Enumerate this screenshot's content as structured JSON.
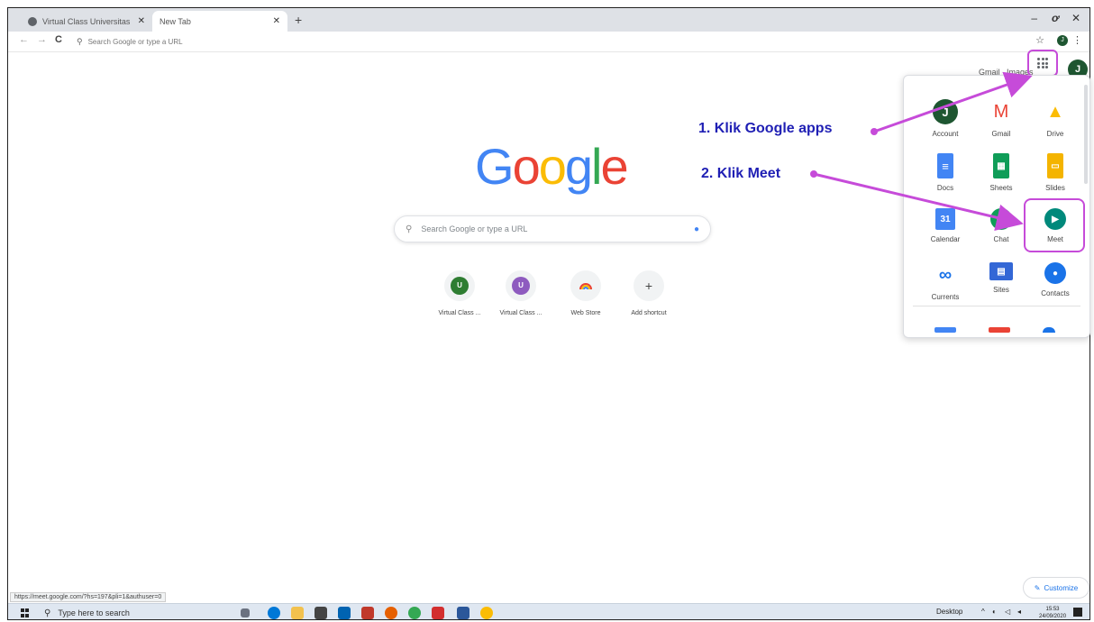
{
  "browser": {
    "tabs": [
      {
        "title": "Virtual Class Universitas Klabat",
        "active": false
      },
      {
        "title": "New Tab",
        "active": true
      }
    ],
    "omnibox_placeholder": "Search Google or type a URL",
    "avatar_letter": "J",
    "status_url": "https://meet.google.com/?hs=197&pli=1&authuser=0"
  },
  "page": {
    "links": {
      "gmail": "Gmail",
      "images": "Images"
    },
    "avatar_letter": "J",
    "logo_letters": [
      "G",
      "o",
      "o",
      "g",
      "l",
      "e"
    ],
    "logo_colors": [
      "#4285F4",
      "#EA4335",
      "#FBBC05",
      "#4285F4",
      "#34A853",
      "#EA4335"
    ],
    "search_placeholder": "Search Google or type a URL",
    "shortcuts": [
      {
        "label": "Virtual Class ...",
        "letter": "U",
        "color": "#2e7d32"
      },
      {
        "label": "Virtual Class ...",
        "letter": "U",
        "color": "#8e5bbf"
      },
      {
        "label": "Web Store",
        "letter": "",
        "color": "#f1f3f4"
      },
      {
        "label": "Add shortcut",
        "letter": "+",
        "color": "#f1f3f4"
      }
    ],
    "customize_label": "Customize"
  },
  "apps_panel": {
    "apps": [
      {
        "label": "Account",
        "icon": "account-icon",
        "color": "#1e5631",
        "glyph": "J"
      },
      {
        "label": "Gmail",
        "icon": "gmail-icon",
        "color": "#ea4335",
        "glyph": "M"
      },
      {
        "label": "Drive",
        "icon": "drive-icon",
        "color": "#fbbc05",
        "glyph": "▲"
      },
      {
        "label": "Docs",
        "icon": "docs-icon",
        "color": "#4285f4",
        "glyph": "≡"
      },
      {
        "label": "Sheets",
        "icon": "sheets-icon",
        "color": "#0f9d58",
        "glyph": "▦"
      },
      {
        "label": "Slides",
        "icon": "slides-icon",
        "color": "#f4b400",
        "glyph": "▭"
      },
      {
        "label": "Calendar",
        "icon": "calendar-icon",
        "color": "#4285f4",
        "glyph": "31"
      },
      {
        "label": "Chat",
        "icon": "chat-icon",
        "color": "#0f9d58",
        "glyph": "@"
      },
      {
        "label": "Meet",
        "icon": "meet-icon",
        "color": "#00897b",
        "glyph": "▶"
      },
      {
        "label": "Currents",
        "icon": "currents-icon",
        "color": "#1a73e8",
        "glyph": "∞"
      },
      {
        "label": "Sites",
        "icon": "sites-icon",
        "color": "#3367d6",
        "glyph": "▤"
      },
      {
        "label": "Contacts",
        "icon": "contacts-icon",
        "color": "#1a73e8",
        "glyph": "●"
      }
    ]
  },
  "annotations": {
    "step1": "1.  Klik Google apps",
    "step2": "2.  Klik Meet",
    "highlight_color": "#c64bd9"
  },
  "taskbar": {
    "search_placeholder": "Type here to search",
    "desktop_label": "Desktop",
    "time": "15:53",
    "date": "24/09/2020"
  }
}
